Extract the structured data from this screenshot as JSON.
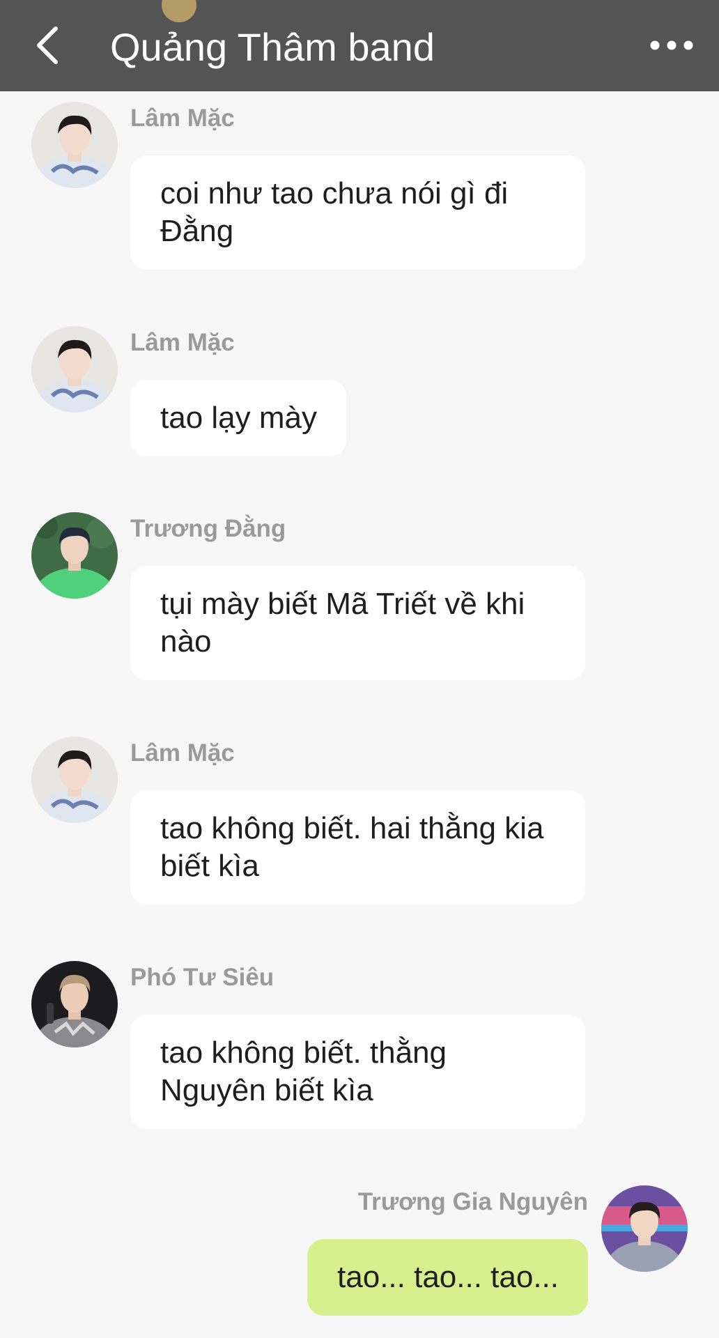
{
  "header": {
    "title": "Quảng Thâm band",
    "back_icon": "chevron-left-icon",
    "more_icon": "more-dots-icon"
  },
  "messages": [
    {
      "sender": "Lâm Mặc",
      "text": "coi như tao chưa nói gì đi Đằng",
      "self": false
    },
    {
      "sender": "Lâm Mặc",
      "text": "tao lạy mày",
      "self": false
    },
    {
      "sender": "Trương Đằng",
      "text": "tụi mày biết Mã Triết về khi nào",
      "self": false
    },
    {
      "sender": "Lâm Mặc",
      "text": "tao không biết. hai thằng kia biết kìa",
      "self": false
    },
    {
      "sender": "Phó Tư Siêu",
      "text": "tao không biết. thằng Nguyên biết kìa",
      "self": false
    },
    {
      "sender": "Trương Gia Nguyên",
      "text": "tao... tao... tao...",
      "self": true
    }
  ],
  "colors": {
    "header_bg": "#545454",
    "page_bg": "#f7f7f7",
    "bubble_other": "#ffffff",
    "bubble_self": "#d6f08e"
  }
}
